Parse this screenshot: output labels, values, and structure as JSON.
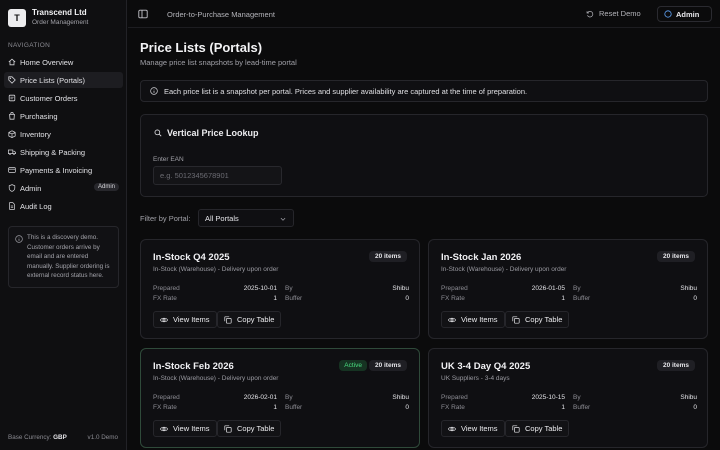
{
  "brand": {
    "initial": "T",
    "name": "Transcend Ltd",
    "subtitle": "Order Management"
  },
  "nav": {
    "label": "NAVIGATION",
    "items": [
      {
        "label": "Home Overview",
        "icon": "home-icon"
      },
      {
        "label": "Price Lists (Portals)",
        "icon": "tag-icon",
        "active": true
      },
      {
        "label": "Customer Orders",
        "icon": "cart-icon"
      },
      {
        "label": "Purchasing",
        "icon": "bag-icon"
      },
      {
        "label": "Inventory",
        "icon": "box-icon"
      },
      {
        "label": "Shipping & Packing",
        "icon": "truck-icon"
      },
      {
        "label": "Payments & Invoicing",
        "icon": "card-icon"
      },
      {
        "label": "Admin",
        "icon": "shield-icon",
        "badge": "Admin"
      },
      {
        "label": "Audit Log",
        "icon": "file-icon"
      }
    ]
  },
  "sidebar_note": "This is a discovery demo. Customer orders arrive by email and are entered manually. Supplier ordering is external record status here.",
  "footer": {
    "currency_label": "Base Currency:",
    "currency": "GBP",
    "version": "v1.0 Demo"
  },
  "topbar": {
    "breadcrumb": "Order-to-Purchase Management",
    "reset": "Reset Demo",
    "role": "Admin"
  },
  "page": {
    "title": "Price Lists (Portals)",
    "subtitle": "Manage price list snapshots by lead-time portal"
  },
  "info_banner": "Each price list is a snapshot per portal. Prices and supplier availability are captured at the time of preparation.",
  "lookup": {
    "title": "Vertical Price Lookup",
    "ean_label": "Enter EAN",
    "ean_placeholder": "e.g. 5012345678901",
    "ean_value": ""
  },
  "filter": {
    "label": "Filter by Portal:",
    "selected": "All Portals"
  },
  "card_labels": {
    "prepared": "Prepared",
    "by": "By",
    "fx": "FX Rate",
    "buffer": "Buffer",
    "view": "View Items",
    "copy": "Copy Table",
    "active": "Active"
  },
  "cards": [
    {
      "title": "In-Stock Q4 2025",
      "desc": "In-Stock (Warehouse) - Delivery upon order",
      "items": "20 items",
      "prepared": "2025-10-01",
      "by": "Shibu",
      "fx": "1",
      "buffer": "0",
      "active": false
    },
    {
      "title": "In-Stock Jan 2026",
      "desc": "In-Stock (Warehouse) - Delivery upon order",
      "items": "20 items",
      "prepared": "2026-01-05",
      "by": "Shibu",
      "fx": "1",
      "buffer": "0",
      "active": false
    },
    {
      "title": "In-Stock Feb 2026",
      "desc": "In-Stock (Warehouse) - Delivery upon order",
      "items": "20 items",
      "prepared": "2026-02-01",
      "by": "Shibu",
      "fx": "1",
      "buffer": "0",
      "active": true
    },
    {
      "title": "UK 3-4 Day Q4 2025",
      "desc": "UK Suppliers - 3-4 days",
      "items": "20 items",
      "prepared": "2025-10-15",
      "by": "Shibu",
      "fx": "1",
      "buffer": "0",
      "active": false
    }
  ]
}
